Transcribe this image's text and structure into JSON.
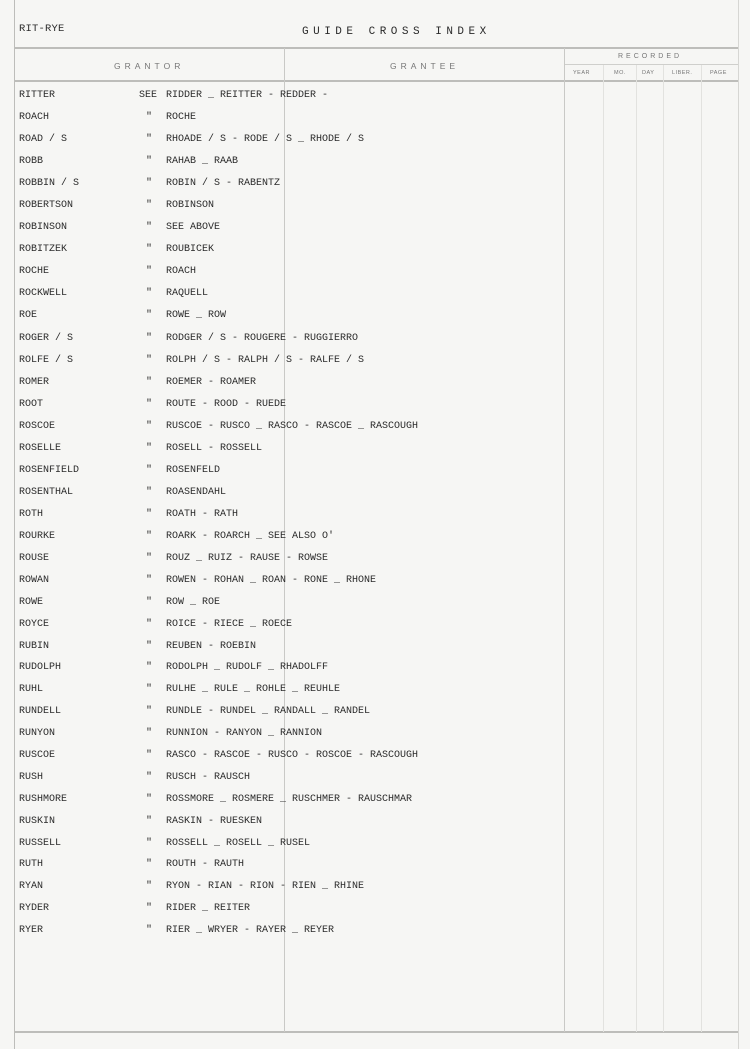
{
  "header": {
    "range": "RIT-RYE",
    "title": "GUIDE CROSS INDEX"
  },
  "columns": {
    "grantor": "GRANTOR",
    "grantee": "GRANTEE",
    "recorded": "RECORDED",
    "recorded_sub": [
      "YEAR",
      "MO.",
      "DAY",
      "LIBER.",
      "PAGE"
    ]
  },
  "ditto_mark": "\"",
  "entries": [
    {
      "grantor": "RITTER",
      "ref": "SEE",
      "grantee": "RIDDER _ REITTER - REDDER -"
    },
    {
      "grantor": "ROACH",
      "ref": "\"",
      "grantee": "ROCHE"
    },
    {
      "grantor": "ROAD / S",
      "ref": "\"",
      "grantee": "RHOADE / S - RODE / S _ RHODE / S"
    },
    {
      "grantor": "ROBB",
      "ref": "\"",
      "grantee": "RAHAB _ RAAB"
    },
    {
      "grantor": "ROBBIN / S",
      "ref": "\"",
      "grantee": "ROBIN / S - RABENTZ"
    },
    {
      "grantor": "ROBERTSON",
      "ref": "\"",
      "grantee": "ROBINSON"
    },
    {
      "grantor": "ROBINSON",
      "ref": "\"",
      "grantee": "SEE ABOVE"
    },
    {
      "grantor": "ROBITZEK",
      "ref": "\"",
      "grantee": "ROUBICEK"
    },
    {
      "grantor": "ROCHE",
      "ref": "\"",
      "grantee": "ROACH"
    },
    {
      "grantor": "ROCKWELL",
      "ref": "\"",
      "grantee": "RAQUELL"
    },
    {
      "grantor": "ROE",
      "ref": "\"",
      "grantee": "ROWE _ ROW"
    },
    {
      "grantor": "ROGER / S",
      "ref": "\"",
      "grantee": "RODGER / S - ROUGERE - RUGGIERRO"
    },
    {
      "grantor": "ROLFE / S",
      "ref": "\"",
      "grantee": "ROLPH / S - RALPH / S - RALFE / S"
    },
    {
      "grantor": "ROMER",
      "ref": "\"",
      "grantee": "ROEMER - ROAMER"
    },
    {
      "grantor": "ROOT",
      "ref": "\"",
      "grantee": "ROUTE - ROOD - RUEDE"
    },
    {
      "grantor": "ROSCOE",
      "ref": "\"",
      "grantee": "RUSCOE - RUSCO _ RASCO - RASCOE _ RASCOUGH"
    },
    {
      "grantor": "ROSELLE",
      "ref": "\"",
      "grantee": "ROSELL - ROSSELL"
    },
    {
      "grantor": "ROSENFIELD",
      "ref": "\"",
      "grantee": "ROSENFELD"
    },
    {
      "grantor": "ROSENTHAL",
      "ref": "\"",
      "grantee": "ROASENDAHL"
    },
    {
      "grantor": "ROTH",
      "ref": "\"",
      "grantee": "ROATH - RATH"
    },
    {
      "grantor": "ROURKE",
      "ref": "\"",
      "grantee": "ROARK - ROARCH _ SEE ALSO O'"
    },
    {
      "grantor": "ROUSE",
      "ref": "\"",
      "grantee": "ROUZ _ RUIZ - RAUSE - ROWSE"
    },
    {
      "grantor": "ROWAN",
      "ref": "\"",
      "grantee": "ROWEN - ROHAN _ ROAN - RONE _ RHONE"
    },
    {
      "grantor": "ROWE",
      "ref": "\"",
      "grantee": "ROW _ ROE"
    },
    {
      "grantor": "ROYCE",
      "ref": "\"",
      "grantee": "ROICE - RIECE _ ROECE"
    },
    {
      "grantor": "RUBIN",
      "ref": "\"",
      "grantee": "REUBEN - ROEBIN"
    },
    {
      "grantor": "RUDOLPH",
      "ref": "\"",
      "grantee": "RODOLPH _ RUDOLF _ RHADOLFF"
    },
    {
      "grantor": "RUHL",
      "ref": "\"",
      "grantee": "RULHE _ RULE _ ROHLE _ REUHLE"
    },
    {
      "grantor": "RUNDELL",
      "ref": "\"",
      "grantee": "RUNDLE - RUNDEL _ RANDALL _ RANDEL"
    },
    {
      "grantor": "RUNYON",
      "ref": "\"",
      "grantee": "RUNNION - RANYON _ RANNION"
    },
    {
      "grantor": "RUSCOE",
      "ref": "\"",
      "grantee": "RASCO - RASCOE - RUSCO - ROSCOE - RASCOUGH"
    },
    {
      "grantor": "RUSH",
      "ref": "\"",
      "grantee": "RUSCH - RAUSCH"
    },
    {
      "grantor": "RUSHMORE",
      "ref": "\"",
      "grantee": "ROSSMORE _ ROSMERE _ RUSCHMER - RAUSCHMAR"
    },
    {
      "grantor": "RUSKIN",
      "ref": "\"",
      "grantee": "RASKIN - RUESKEN"
    },
    {
      "grantor": "RUSSELL",
      "ref": "\"",
      "grantee": "ROSSELL _ ROSELL _ RUSEL"
    },
    {
      "grantor": "RUTH",
      "ref": "\"",
      "grantee": "ROUTH - RAUTH"
    },
    {
      "grantor": "RYAN",
      "ref": "\"",
      "grantee": "RYON - RIAN - RION - RIEN _ RHINE"
    },
    {
      "grantor": "RYDER",
      "ref": "\"",
      "grantee": "RIDER _ REITER"
    },
    {
      "grantor": "RYER",
      "ref": "\"",
      "grantee": "RIER _ WRYER - RAYER _ REYER"
    }
  ]
}
